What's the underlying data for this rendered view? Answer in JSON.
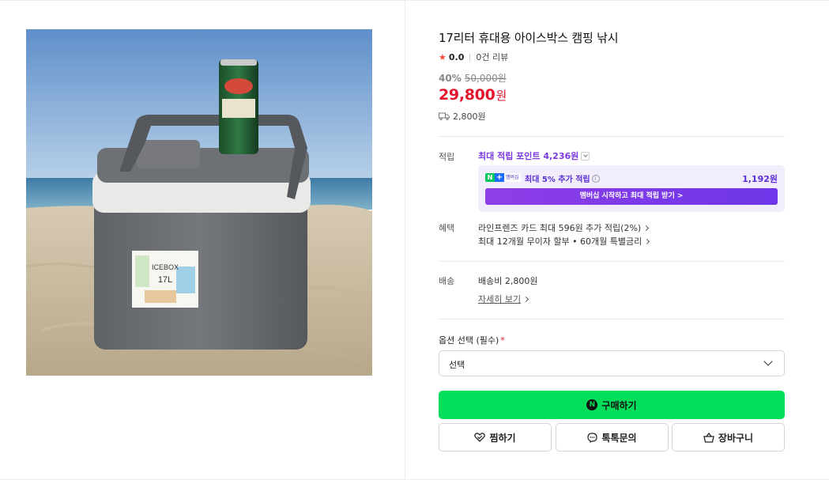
{
  "product": {
    "title": "17리터 휴대용 아이스박스 캠핑 낚시",
    "image_icon": "product-photo-icebox-on-beach",
    "cooler_label_brand": "ICEBOX",
    "cooler_label_size": "17L"
  },
  "rating": {
    "icon": "star-icon",
    "score": "0.0",
    "review_count": "0건 리뷰"
  },
  "price": {
    "discount_rate": "40%",
    "original_price": "50,000원",
    "sale_price": "29,800",
    "sale_unit": "원",
    "shipping_fee": "2,800원"
  },
  "points": {
    "label": "적립",
    "max_points": "최대 적립 포인트 4,236원",
    "badge_label": "멤버십",
    "membership_text": "최대 5% 추가 적립",
    "membership_amount": "1,192원",
    "membership_button": "멤버십 시작하고 최대 적립 받기 >"
  },
  "benefits": {
    "label": "혜택",
    "items": [
      "라인프렌즈 카드 최대 596원 추가 적립(2%)",
      "최대 12개월 무이자 할부 • 60개월 특별금리"
    ]
  },
  "delivery": {
    "label": "배송",
    "fee": "배송비 2,800원",
    "detail_link": "자세히 보기"
  },
  "option": {
    "label": "옵션 선택 (필수)",
    "required_mark": "*",
    "selected_value": "선택"
  },
  "actions": {
    "buy": "구매하기",
    "wish": "찜하기",
    "talk": "톡톡문의",
    "cart": "장바구니"
  },
  "colors": {
    "sale_red": "#e4162e",
    "naver_green": "#03de5a",
    "points_purple": "#7a39e0"
  }
}
